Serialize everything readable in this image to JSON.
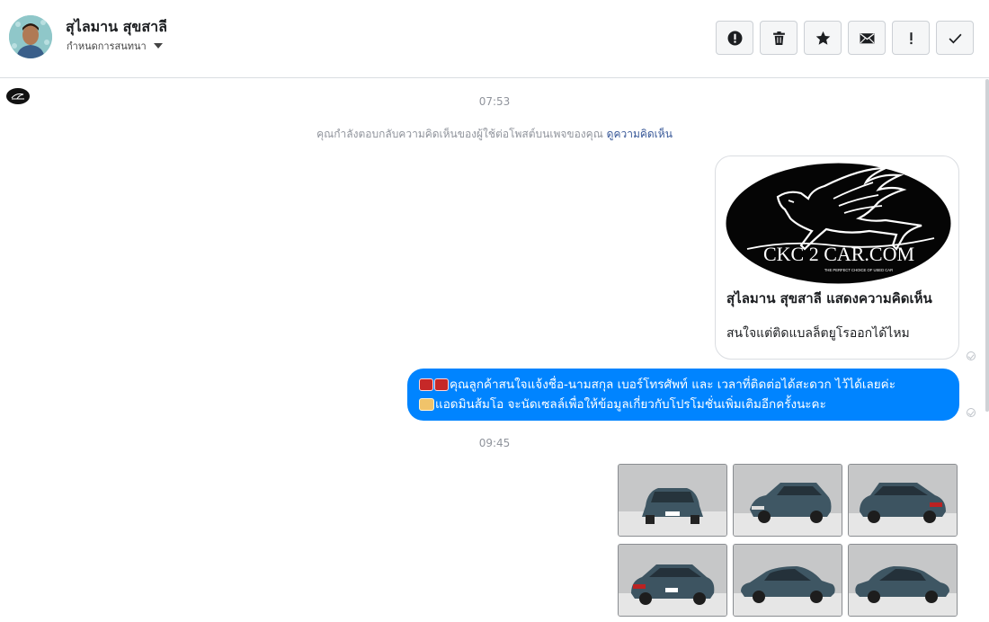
{
  "header": {
    "name": "สุไลมาน สุขสาลี",
    "subtitle": "กำหนดการสนทนา"
  },
  "toolbar": [
    {
      "icon": "alert-circle-icon",
      "name": "spam-button"
    },
    {
      "icon": "trash-icon",
      "name": "delete-button"
    },
    {
      "icon": "star-icon",
      "name": "star-button"
    },
    {
      "icon": "envelope-icon",
      "name": "mark-unread-button"
    },
    {
      "icon": "exclamation-icon",
      "name": "follow-up-button"
    },
    {
      "icon": "check-icon",
      "name": "done-button"
    }
  ],
  "thread": {
    "time_1": "07:53",
    "notice_text": "คุณกำลังตอบกลับความคิดเห็นของผู้ใช้ต่อโพสต์บนเพจของคุณ ",
    "notice_link": "ดูความคิดเห็น",
    "card": {
      "logo_text": "CKC 2 CAR.COM",
      "logo_tagline": "THE PERFECT CHOICE OF USED CAR",
      "title": "สุไลมาน สุขสาลี แสดงความคิดเห็น",
      "comment": "สนใจแต่ติดแบลล็ตยูโรออกได้ไหม"
    },
    "bubble": {
      "line1": "คุณลูกค้าสนใจแจ้งชื่อ-นามสกุล เบอร์โทรศัพท์ และ เวลาที่ติดต่อได้สะดวก ไว้ได้เลยค่ะ",
      "line2": "แอดมินส้มโอ จะนัดเซลล์เพื่อให้ข้อมูลเกี่ยวกับโปรโมชั่นเพิ่มเติมอีกครั้งนะคะ"
    },
    "time_2": "09:45",
    "photos": [
      {
        "view": "front"
      },
      {
        "view": "front-three-quarter"
      },
      {
        "view": "rear-three-quarter"
      },
      {
        "view": "rear-three-quarter-left"
      },
      {
        "view": "side-right"
      },
      {
        "view": "side-left"
      }
    ]
  },
  "colors": {
    "accent": "#0084ff",
    "link": "#385898",
    "muted": "#90949c"
  }
}
